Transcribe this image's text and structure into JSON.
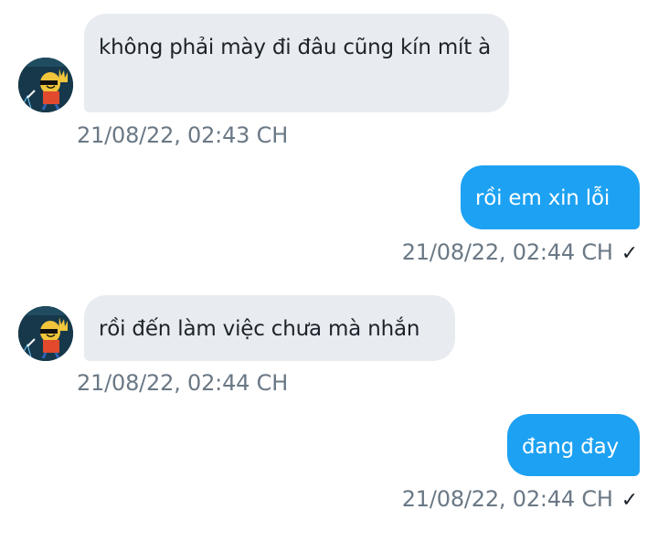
{
  "conversation": {
    "messages": [
      {
        "direction": "incoming",
        "text": "không phải mày đi đâu cũng kín mít à",
        "timestamp": "21/08/22,  02:43 CH"
      },
      {
        "direction": "outgoing",
        "text": "rồi em xin lỗi",
        "timestamp": "21/08/22,  02:44 CH",
        "status_icon": "checkmark-icon",
        "status_glyph": "✓"
      },
      {
        "direction": "incoming",
        "text": "rồi đến làm việc chưa mà nhắn",
        "timestamp": "21/08/22,  02:44 CH"
      },
      {
        "direction": "outgoing",
        "text": "đang đay",
        "timestamp": "21/08/22,  02:44 CH",
        "status_icon": "checkmark-icon",
        "status_glyph": "✓"
      }
    ]
  },
  "colors": {
    "incoming_bubble": "#e8ecf0",
    "outgoing_bubble": "#1da1f2",
    "timestamp": "#6a7885",
    "text_dark": "#1d232b"
  }
}
